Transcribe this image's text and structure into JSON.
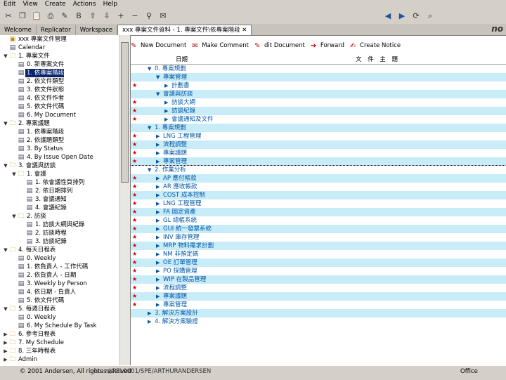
{
  "menu": [
    "Edit",
    "View",
    "Create",
    "Actions",
    "Help"
  ],
  "tabs": [
    {
      "label": "Welcome"
    },
    {
      "label": "Replicator"
    },
    {
      "label": "Workspace"
    },
    {
      "label": "xxx 專案文件資料 - 1. 專案文件\\依專案階段",
      "active": true
    }
  ],
  "brand": "no",
  "nav": [
    {
      "label": "xxx 專案文件管理",
      "level": 0,
      "icon": "db"
    },
    {
      "label": "Calendar",
      "level": 0,
      "icon": "doc"
    },
    {
      "label": "1. 專案文件",
      "level": 0,
      "icon": "folder",
      "exp": "▼"
    },
    {
      "label": "0. 新專案文件",
      "level": 1,
      "icon": "doc"
    },
    {
      "label": "1. 依專案階段",
      "level": 1,
      "icon": "doc",
      "selected": true
    },
    {
      "label": "2. 依文件類型",
      "level": 1,
      "icon": "doc"
    },
    {
      "label": "3. 依文件狀態",
      "level": 1,
      "icon": "doc"
    },
    {
      "label": "4. 依文件作者",
      "level": 1,
      "icon": "doc"
    },
    {
      "label": "5. 依文件代碼",
      "level": 1,
      "icon": "doc"
    },
    {
      "label": "6. My Document",
      "level": 1,
      "icon": "doc"
    },
    {
      "label": "2. 專案議題",
      "level": 0,
      "icon": "folder",
      "exp": "▼"
    },
    {
      "label": "1. 依專案階段",
      "level": 1,
      "icon": "doc"
    },
    {
      "label": "2. 依議題類型",
      "level": 1,
      "icon": "doc"
    },
    {
      "label": "3. By Status",
      "level": 1,
      "icon": "doc"
    },
    {
      "label": "4. By Issue Open Date",
      "level": 1,
      "icon": "doc"
    },
    {
      "label": "3. 會議與訪談",
      "level": 0,
      "icon": "folder",
      "exp": "▼"
    },
    {
      "label": "1. 會議",
      "level": 1,
      "icon": "folder",
      "exp": "▼"
    },
    {
      "label": "1. 依會議性質排列",
      "level": 2,
      "icon": "doc"
    },
    {
      "label": "2. 依日期排列",
      "level": 2,
      "icon": "doc"
    },
    {
      "label": "3. 會議通知",
      "level": 2,
      "icon": "doc"
    },
    {
      "label": "4. 會議紀錄",
      "level": 2,
      "icon": "doc"
    },
    {
      "label": "2. 訪談",
      "level": 1,
      "icon": "folder",
      "exp": "▼"
    },
    {
      "label": "1. 訪談大綱與紀錄",
      "level": 2,
      "icon": "doc"
    },
    {
      "label": "2. 訪談時程",
      "level": 2,
      "icon": "doc"
    },
    {
      "label": "3. 訪談紀錄",
      "level": 2,
      "icon": "doc"
    },
    {
      "label": "4. 每天日程表",
      "level": 0,
      "icon": "folder",
      "exp": "▼"
    },
    {
      "label": "0. Weekly",
      "level": 1,
      "icon": "doc"
    },
    {
      "label": "1. 依負責人 - 工作代碼",
      "level": 1,
      "icon": "doc"
    },
    {
      "label": "2. 依負責人 - 日期",
      "level": 1,
      "icon": "doc"
    },
    {
      "label": "3. Weekly by Person",
      "level": 1,
      "icon": "doc"
    },
    {
      "label": "4. 依日期 - 負責人",
      "level": 1,
      "icon": "doc"
    },
    {
      "label": "5. 依文件代碼",
      "level": 1,
      "icon": "doc"
    },
    {
      "label": "5. 每週日程表",
      "level": 0,
      "icon": "folder",
      "exp": "▼"
    },
    {
      "label": "0. Weekly",
      "level": 1,
      "icon": "doc"
    },
    {
      "label": "6. My Schedule By Task",
      "level": 1,
      "icon": "doc"
    },
    {
      "label": "6. 參考日程表",
      "level": 0,
      "icon": "folder",
      "exp": "▶"
    },
    {
      "label": "7. My Schedule",
      "level": 0,
      "icon": "folder",
      "exp": "▶"
    },
    {
      "label": "8. 三年時程表",
      "level": 0,
      "icon": "folder",
      "exp": "▶"
    },
    {
      "label": "Admin",
      "level": 0,
      "icon": "folder",
      "exp": "▶"
    }
  ],
  "view_toolbar": [
    {
      "label": "New Document",
      "icon": "new-doc-icon",
      "glyph": "✎"
    },
    {
      "label": "Make Comment",
      "icon": "comment-icon",
      "glyph": "✉"
    },
    {
      "label": "dit Document",
      "icon": "edit-doc-icon",
      "glyph": "✎"
    },
    {
      "label": "Forward",
      "icon": "forward-icon",
      "glyph": "➔"
    },
    {
      "label": "Create Notice",
      "icon": "notice-icon",
      "glyph": "✍"
    }
  ],
  "columns": {
    "date": "日期",
    "title": "文 件 主 題"
  },
  "rows": [
    {
      "level": 0,
      "exp": "▼",
      "text": "0. 專案規劃",
      "star": false
    },
    {
      "level": 1,
      "exp": "▼",
      "text": "專案管理",
      "star": false
    },
    {
      "level": 2,
      "exp": "▶",
      "text": "計劃書",
      "star": true
    },
    {
      "level": 1,
      "exp": "▼",
      "text": "會議與訪談",
      "star": false
    },
    {
      "level": 2,
      "exp": "▶",
      "text": "訪談大綱",
      "star": true
    },
    {
      "level": 2,
      "exp": "▶",
      "text": "訪談紀錄",
      "star": true
    },
    {
      "level": 2,
      "exp": "▶",
      "text": "會議通知及文件",
      "star": true
    },
    {
      "level": 0,
      "exp": "▼",
      "text": "1. 專案規劃",
      "star": false
    },
    {
      "level": 1,
      "exp": "▶",
      "text": "LNG 工程管理",
      "star": true
    },
    {
      "level": 1,
      "exp": "▶",
      "text": "流程調整",
      "star": true
    },
    {
      "level": 1,
      "exp": "▶",
      "text": "專案議題",
      "star": true
    },
    {
      "level": 1,
      "exp": "▶",
      "text": "專案管理",
      "star": true
    },
    {
      "level": 0,
      "exp": "▼",
      "text": "2. 作業分析",
      "star": false,
      "boxed": true
    },
    {
      "level": 1,
      "exp": "▶",
      "text": "AP 應付帳款",
      "star": true
    },
    {
      "level": 1,
      "exp": "▶",
      "text": "AR 應收帳款",
      "star": true
    },
    {
      "level": 1,
      "exp": "▶",
      "text": "COST 成本控制",
      "star": true
    },
    {
      "level": 1,
      "exp": "▶",
      "text": "LNG 工程管理",
      "star": true
    },
    {
      "level": 1,
      "exp": "▶",
      "text": "FA 固定資產",
      "star": true
    },
    {
      "level": 1,
      "exp": "▶",
      "text": "GL 總帳系統",
      "star": true
    },
    {
      "level": 1,
      "exp": "▶",
      "text": "GUI 統一發票系統",
      "star": true
    },
    {
      "level": 1,
      "exp": "▶",
      "text": "INV 庫存管理",
      "star": true
    },
    {
      "level": 1,
      "exp": "▶",
      "text": "MRP 物料需求計劃",
      "star": true
    },
    {
      "level": 1,
      "exp": "▶",
      "text": "NM 非預定碼",
      "star": true
    },
    {
      "level": 1,
      "exp": "▶",
      "text": "OE 訂單管理",
      "star": true
    },
    {
      "level": 1,
      "exp": "▶",
      "text": "PO 採購管理",
      "star": true
    },
    {
      "level": 1,
      "exp": "▶",
      "text": "WIP 在製品管理",
      "star": true
    },
    {
      "level": 1,
      "exp": "▶",
      "text": "流程調整",
      "star": true
    },
    {
      "level": 1,
      "exp": "▶",
      "text": "專案議題",
      "star": true
    },
    {
      "level": 1,
      "exp": "▶",
      "text": "專案管理",
      "star": true
    },
    {
      "level": 0,
      "exp": "▶",
      "text": "3. 解決方案設計",
      "star": false
    },
    {
      "level": 0,
      "exp": "▶",
      "text": "4. 解決方案驗證",
      "star": false
    }
  ],
  "status": {
    "copyright": "© 2001 Andersen, All rights reserved",
    "path": "notes://PEL0001/SPE/ARTHURANDERSEN",
    "office": "Office"
  }
}
